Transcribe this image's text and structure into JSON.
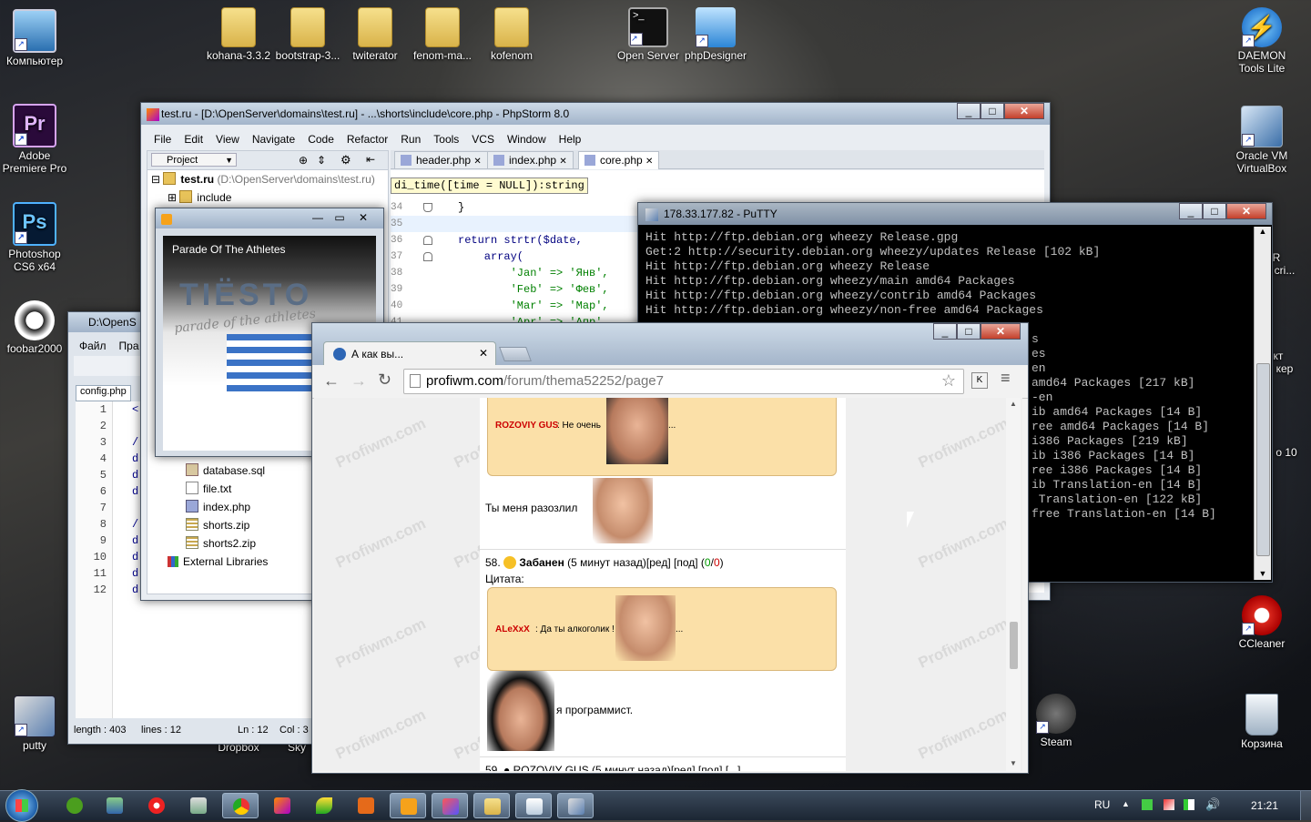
{
  "desktop": {
    "icons_left": [
      {
        "label": "Компьютер"
      },
      {
        "label": "Adobe Premiere Pro"
      },
      {
        "label": "Photoshop CS6 x64"
      },
      {
        "label": "foobar2000"
      },
      {
        "label": "putty"
      }
    ],
    "icons_top": [
      {
        "label": "kohana-3.3.2"
      },
      {
        "label": "bootstrap-3..."
      },
      {
        "label": "twiterator"
      },
      {
        "label": "fenom-ma..."
      },
      {
        "label": "kofenom"
      },
      {
        "label": "Open Server"
      },
      {
        "label": "phpDesigner"
      }
    ],
    "icons_right": [
      {
        "label": "DAEMON Tools Lite"
      },
      {
        "label": "Oracle VM VirtualBox"
      },
      {
        "label": "CCleaner"
      },
      {
        "label": "Steam"
      },
      {
        "label": "Корзина"
      }
    ],
    "partial_labels": [
      "Dropbox",
      "Sky",
      "R",
      "cri...",
      "кт",
      "кер",
      "o 10"
    ]
  },
  "phpstorm": {
    "title": "test.ru - [D:\\OpenServer\\domains\\test.ru] - ...\\shorts\\include\\core.php - PhpStorm 8.0",
    "menu": [
      "File",
      "Edit",
      "View",
      "Navigate",
      "Code",
      "Refactor",
      "Run",
      "Tools",
      "VCS",
      "Window",
      "Help"
    ],
    "project_dropdown": "Project",
    "tabs": [
      "header.php",
      "index.php",
      "core.php"
    ],
    "active_tab": "core.php",
    "hint": "di_time([time = NULL]):string",
    "tree": [
      {
        "name": "test.ru",
        "path": "(D:\\OpenServer\\domains\\test.ru)"
      },
      {
        "name": "include"
      },
      {
        "name": "database.sql"
      },
      {
        "name": "file.txt"
      },
      {
        "name": "index.php"
      },
      {
        "name": "shorts.zip"
      },
      {
        "name": "shorts2.zip"
      },
      {
        "name": "External Libraries"
      }
    ],
    "line_numbers": [
      "34",
      "35",
      "36",
      "37",
      "38",
      "39",
      "40",
      "41"
    ],
    "code": [
      "}",
      "",
      "return strtr($date,",
      "    array(",
      "        'Jan' => 'Янв',",
      "        'Feb' => 'Фев',",
      "        'Mar' => 'Мар',",
      "        'Apr' => 'Апр'"
    ]
  },
  "editor2": {
    "title": "D:\\OpenS",
    "menu": [
      "Файл",
      "Пра"
    ],
    "tab": "config.php",
    "line_numbers": [
      "1",
      "2",
      "3",
      "4",
      "5",
      "6",
      "7",
      "8",
      "9",
      "10",
      "11",
      "12"
    ],
    "gutter": [
      "<",
      "",
      "/",
      "d",
      "d",
      "d",
      "",
      "/",
      "d",
      "d",
      "d",
      "d"
    ],
    "status": {
      "length": "length : 403",
      "lines": "lines : 12",
      "ln": "Ln : 12",
      "col": "Col : 3"
    }
  },
  "player": {
    "track": "Parade Of The Athletes",
    "logo": "TIЁSTO",
    "subtitle": "parade of the athletes"
  },
  "putty": {
    "title": "178.33.177.82 - PuTTY",
    "lines": [
      "Hit http://ftp.debian.org wheezy Release.gpg",
      "Get:2 http://security.debian.org wheezy/updates Release [102 kB]",
      "Hit http://ftp.debian.org wheezy Release",
      "Hit http://ftp.debian.org wheezy/main amd64 Packages",
      "Hit http://ftp.debian.org wheezy/contrib amd64 Packages",
      "Hit http://ftp.debian.org wheezy/non-free amd64 Packages"
    ],
    "right_lines": [
      "s",
      "es",
      "en",
      "amd64 Packages [217 kB]",
      "-en",
      "ib amd64 Packages [14 B]",
      "ree amd64 Packages [14 B]",
      "i386 Packages [219 kB]",
      "ib i386 Packages [14 B]",
      "ree i386 Packages [14 B]",
      "ib Translation-en [14 B]",
      " Translation-en [122 kB]",
      "free Translation-en [14 B]"
    ]
  },
  "browser": {
    "tab_title": "А как вы...",
    "url_domain": "profiwm.com",
    "url_path": "/forum/thema52252/page7",
    "quote1_user": "ROZOVIY GUS",
    "quote1_text": ": Не очень",
    "quote1_more": "...",
    "reply1": "Ты меня разозлил",
    "post58_num": "58.",
    "post58_user": "Забанен",
    "post58_meta": "(5 минут назад)[ред] [под] (",
    "post58_v1": "0",
    "post58_sep": "/",
    "post58_v2": "0",
    "post58_end": ")",
    "quote_label": "Цитата:",
    "quote2_user": "ALeXxX",
    "quote2_text": ": Да ты алкоголик !",
    "quote2_more": "...",
    "reply2": "я программист.",
    "next_post": "59. ● ROZOVIY GUS (5 минут назад)[ред] [под] [...]",
    "watermark": "Profiwm.com"
  },
  "taskbar": {
    "language": "RU",
    "time": "21:21"
  }
}
